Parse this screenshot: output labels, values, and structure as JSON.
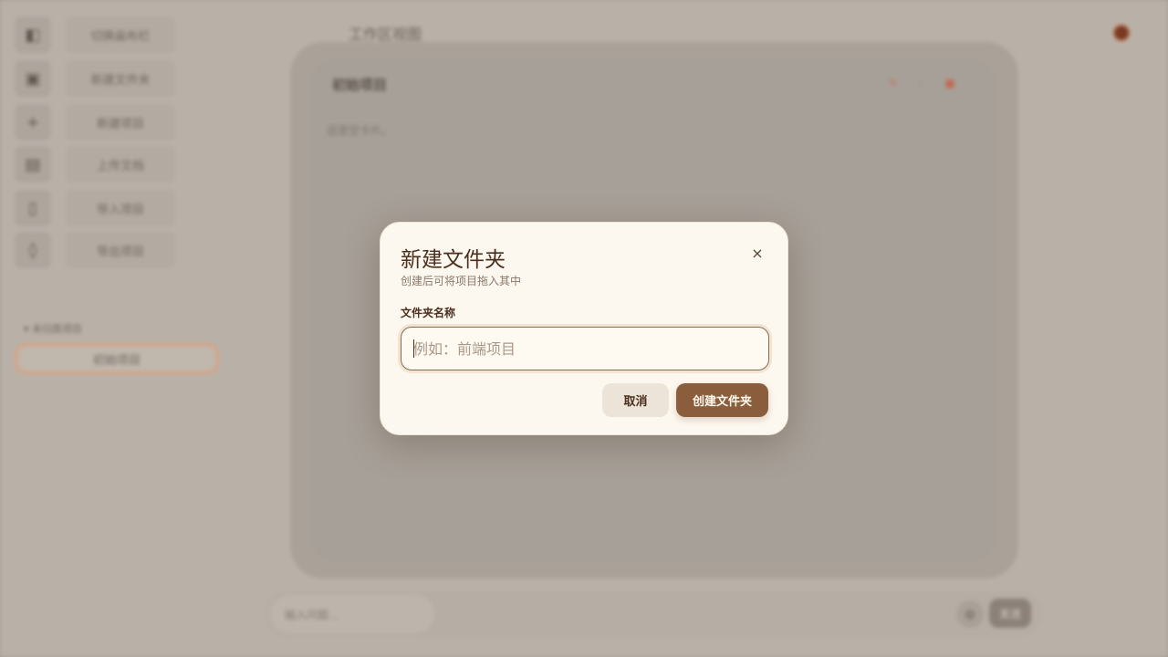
{
  "sidebar": {
    "items": [
      {
        "label": "切换画布栏",
        "icon": "sidebar-toggle-icon"
      },
      {
        "label": "新建文件夹",
        "icon": "folder-add-icon"
      },
      {
        "label": "新建项目",
        "icon": "plus-icon"
      },
      {
        "label": "上传文档",
        "icon": "document-icon"
      },
      {
        "label": "导入项目",
        "icon": "import-icon"
      },
      {
        "label": "导出项目",
        "icon": "export-icon"
      }
    ],
    "section_label": "未归类项目",
    "project_label": "初始项目"
  },
  "workspace": {
    "title": "工作区视图"
  },
  "canvas": {
    "card_title": "初始项目",
    "empty_text": "这是空卡片。"
  },
  "chat": {
    "placeholder": "输入问题...",
    "send_label": "发送"
  },
  "modal": {
    "title": "新建文件夹",
    "subtitle": "创建后可将项目拖入其中",
    "close_symbol": "×",
    "field_label": "文件夹名称",
    "field_placeholder": "例如：前端项目",
    "field_value": "",
    "cancel_label": "取消",
    "create_label": "创建文件夹"
  },
  "colors": {
    "modal_bg": "#fdf8ef",
    "accent": "#8a5d3d",
    "title_text": "#4a2f1e"
  }
}
